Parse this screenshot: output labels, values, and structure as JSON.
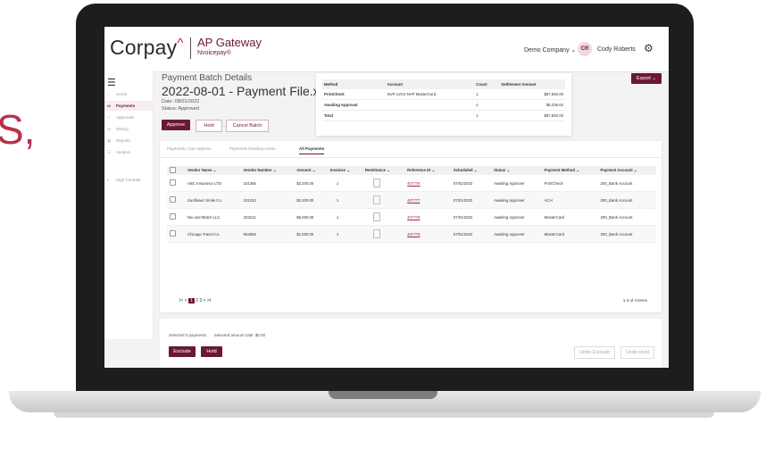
{
  "background_text": "S,",
  "header": {
    "logo": "Corpay",
    "app_name": "AP Gateway",
    "app_sub": "Nvoicepay®",
    "company": "Demo Company",
    "user_initials": "CR",
    "user_name": "Cody Roberts"
  },
  "sidebar": {
    "items": [
      {
        "label": "Home",
        "icon": "home-icon",
        "glyph": "⌂"
      },
      {
        "label": "Payments",
        "icon": "card-icon",
        "glyph": "▭",
        "active": true
      },
      {
        "label": "Approvals",
        "icon": "check-icon",
        "glyph": "✓"
      },
      {
        "label": "History",
        "icon": "clock-icon",
        "glyph": "◷"
      },
      {
        "label": "Reports",
        "icon": "chart-icon",
        "glyph": "▥"
      },
      {
        "label": "Vendors",
        "icon": "users-icon",
        "glyph": "☷"
      },
      {
        "label": "High Contrast",
        "icon": "contrast-icon",
        "glyph": "◐"
      }
    ]
  },
  "batch": {
    "heading": "Payment Batch Details",
    "title": "2022-08-01 - Payment File.xlsx",
    "date": "Date: 08/01/2022",
    "status": "Status: Approved",
    "approve": "Approve",
    "hold": "Hold",
    "cancel": "Cancel Batch"
  },
  "export": "Export",
  "summary": {
    "headers": [
      "Method",
      "Account",
      "Count",
      "Settlement Amount"
    ],
    "rows": [
      [
        "PrintCheck",
        "NVP LVAO NVP MasterCard",
        "1",
        "$87,840.00"
      ],
      [
        "Awaiting Approval",
        "",
        "4",
        "$8,235.62"
      ],
      [
        "Total",
        "",
        "1",
        "$87,840.00"
      ]
    ]
  },
  "tabs": [
    "Payments I Can Approve",
    "Payments Needing Action",
    "All Payments"
  ],
  "table": {
    "headers": [
      "Vendor Name",
      "Vendor Number",
      "Amount",
      "Invoices",
      "Remittance",
      "Reference ID",
      "Scheduled",
      "Status",
      "Payment Method",
      "Payment Account"
    ],
    "rows": [
      [
        "ABC Insurance LTD",
        "101366",
        "$2,200.00",
        "1",
        "",
        "407776",
        "07/01/2022",
        "Awaiting Approver",
        "PrintCheck",
        "200_Bank Account"
      ],
      [
        "Sunflower Smile Co.",
        "101310",
        "$2,200.00",
        "1",
        "",
        "407777",
        "07/01/2022",
        "Awaiting Approver",
        "ACH",
        "200_Bank Account"
      ],
      [
        "Nix and Match LLC.",
        "223211",
        "$5,000.00",
        "1",
        "",
        "407778",
        "07/01/2022",
        "Awaiting Approver",
        "MasterCard",
        "200_Bank Account"
      ],
      [
        "Chicago Travel Co.",
        "944555",
        "$1,000.00",
        "1",
        "",
        "407779",
        "07/01/2022",
        "Awaiting Approver",
        "MasterCard",
        "200_Bank Account"
      ]
    ]
  },
  "pager": {
    "first": "I<",
    "prev": "<",
    "current": "1",
    "p2": "2",
    "p3": "3",
    "next": ">",
    "last": ">I"
  },
  "items_count": "1-4 of 4 items",
  "footer": {
    "selected": "Selected 0 payments",
    "total_label": "Selected amount total",
    "total_value": "$0.00",
    "exclude": "Exclude",
    "hold": "Hold",
    "undo_exclude": "Undo Exclude",
    "undo_hold": "Undo Hold"
  },
  "colors": {
    "brand": "#6b1930",
    "accent": "#c4253f"
  }
}
